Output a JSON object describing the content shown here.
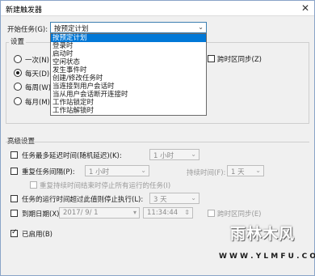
{
  "window": {
    "title": "新建触发器",
    "close_glyph": "✕"
  },
  "begin_task": {
    "label": "开始任务(G):",
    "selected": "按预定计划"
  },
  "settings_group": {
    "title": "设置"
  },
  "schedule": {
    "once": "一次(N)",
    "daily": "每天(D)",
    "weekly": "每周(W)",
    "monthly": "每月(M)",
    "selected": "daily"
  },
  "sync_tz_top": {
    "label": "跨时区同步(Z)"
  },
  "dropdown": {
    "options": [
      "按预定计划",
      "登录时",
      "启动时",
      "空闲状态",
      "发生事件时",
      "创建/修改任务时",
      "当连接到用户会话时",
      "当从用户会话断开连接时",
      "工作站锁定时",
      "工作站解锁时"
    ],
    "highlighted_index": 0
  },
  "advanced": {
    "title": "高级设置",
    "delay": {
      "label": "任务最多延迟时间(随机延迟)(K):",
      "value": "1 小时",
      "checked": false
    },
    "repeat": {
      "label": "重复任务间隔(P):",
      "value": "1 小时",
      "duration_label": "持续时间(F):",
      "duration_value": "1 天",
      "checked": false
    },
    "stop_all": {
      "label": "重复持续时间结束时停止所有运行的任务(I)",
      "checked": false
    },
    "stop_longer": {
      "label": "任务的运行时间超过此值则停止执行(L):",
      "value": "3 天",
      "checked": false
    },
    "expire": {
      "label": "到期日期(X):",
      "date": "2017/ 9/ 1",
      "time": "11:34:44",
      "sync_label": "跨时区同步(E)",
      "checked": false
    },
    "enabled": {
      "label": "已启用(B)",
      "checked": true
    }
  },
  "watermark": {
    "brand": "雨林木风",
    "url": "W W W . Y L M F U . C O M"
  }
}
